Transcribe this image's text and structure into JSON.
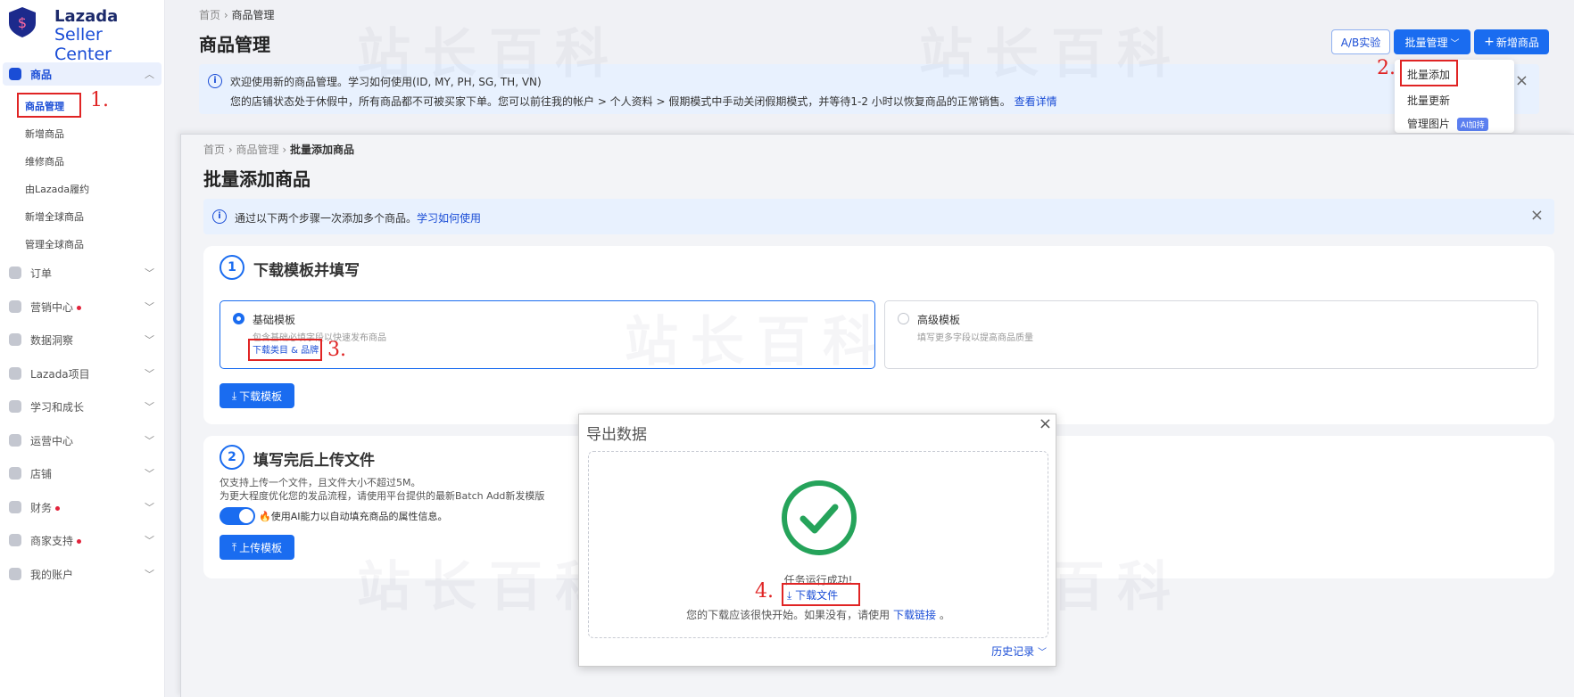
{
  "app": {
    "brand_line1": "Lazada",
    "brand_line2": "Seller Center"
  },
  "sidebar": {
    "product": "商品",
    "sub_items": [
      "商品管理",
      "新增商品",
      "维修商品",
      "由Lazada履约",
      "新增全球商品",
      "管理全球商品"
    ],
    "groups": [
      {
        "label": "订单",
        "dot": false
      },
      {
        "label": "营销中心",
        "dot": true
      },
      {
        "label": "数据洞察",
        "dot": false
      },
      {
        "label": "Lazada项目",
        "dot": false
      },
      {
        "label": "学习和成长",
        "dot": false
      },
      {
        "label": "运营中心",
        "dot": false
      },
      {
        "label": "店铺",
        "dot": false
      },
      {
        "label": "财务",
        "dot": true
      },
      {
        "label": "商家支持",
        "dot": true
      },
      {
        "label": "我的账户",
        "dot": false
      }
    ]
  },
  "back_page": {
    "crumb_home": "首页",
    "crumb_current": "商品管理",
    "title": "商品管理",
    "ab_button": "A/B实验",
    "bulk_button": "批量管理",
    "add_button": "新增商品",
    "banner_line1": "欢迎使用新的商品管理。学习如何使用(ID, MY, PH, SG, TH, VN)",
    "banner_line2": "您的店铺状态处于休假中，所有商品都不可被买家下单。您可以前往我的帐户 > 个人资料 > 假期模式中手动关闭假期模式，并等待1-2 小时以恢复商品的正常销售。",
    "banner_link": "查看详情",
    "dropdown": {
      "add": "批量添加",
      "update": "批量更新",
      "images": "管理图片",
      "ai_tag": "AI加持"
    }
  },
  "front_page": {
    "crumb": [
      "首页",
      "商品管理",
      "批量添加商品"
    ],
    "title": "批量添加商品",
    "info": "通过以下两个步骤一次添加多个商品。",
    "info_link": "学习如何使用",
    "step1": {
      "num": "1",
      "title": "下载模板并填写",
      "basic": "基础模板",
      "basic_desc": "包含基础必填字段以快速发布商品",
      "basic_link": "下载类目 & 品牌",
      "advanced": "高级模板",
      "advanced_desc": "填写更多字段以提高商品质量",
      "download_btn": "下载模板"
    },
    "step2": {
      "num": "2",
      "title": "填写完后上传文件",
      "line1": "仅支持上传一个文件，且文件大小不超过5M。",
      "line2": "为更大程度优化您的发品流程，请使用平台提供的最新Batch Add新发模版",
      "ai_text": "使用AI能力以自动填充商品的属性信息。",
      "upload_btn": "上传模板"
    }
  },
  "modal": {
    "title": "导出数据",
    "success": "任务运行成功!",
    "download_file": "下载文件",
    "hint": "您的下载应该很快开始。如果没有，请使用",
    "hint_link": "下载链接",
    "hint_end": "。",
    "history": "历史记录"
  },
  "annotations": {
    "s1": "1.",
    "s2": "2.",
    "s3": "3.",
    "s4": "4."
  },
  "watermark": "站长百科",
  "colors": {
    "primary": "#1a6cf0",
    "annotation": "#e02424",
    "success": "#25a35a"
  }
}
